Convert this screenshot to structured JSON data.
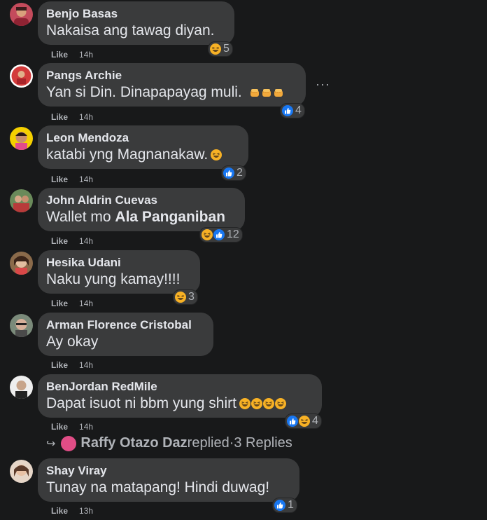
{
  "comments": [
    {
      "name": "Benjo Basas",
      "text": "Nakaisa ang tawag diyan.",
      "reaction_count": "5",
      "like": "Like",
      "time": "14h"
    },
    {
      "name": "Pangs Archie",
      "text": "Yan si Din. Dinapapayag muli.",
      "reaction_count": "4",
      "like": "Like",
      "time": "14h",
      "more": "···"
    },
    {
      "name": "Leon Mendoza",
      "text": "katabi yng Magnanakaw.",
      "reaction_count": "2",
      "like": "Like",
      "time": "14h"
    },
    {
      "name": "John Aldrin Cuevas",
      "text_prefix": "Wallet mo ",
      "text_mention": "Ala Panganiban",
      "reaction_count": "12",
      "like": "Like",
      "time": "14h"
    },
    {
      "name": "Hesika Udani",
      "text": "Naku yung kamay!!!!",
      "reaction_count": "3",
      "like": "Like",
      "time": "14h"
    },
    {
      "name": "Arman Florence Cristobal",
      "text": "Ay okay",
      "like": "Like",
      "time": "14h"
    },
    {
      "name": "BenJordan RedMile",
      "text": "Dapat isuot ni bbm yung shirt",
      "reaction_count": "4",
      "like": "Like",
      "time": "14h"
    },
    {
      "name": "Shay Viray",
      "text": "Tunay na matapang! Hindi duwag!",
      "reaction_count": "1",
      "like": "Like",
      "time": "13h"
    }
  ],
  "reply": {
    "arrow": "↪",
    "name": "Raffy Otazo Daz",
    "suffix": " replied",
    "separator": " · ",
    "count": "3 Replies"
  },
  "colors": {
    "background": "#18191a",
    "bubble": "#3a3b3c",
    "like_blue": "#1877f2",
    "haha_yellow": "#f7b125"
  },
  "icons": [
    "haha-icon",
    "like-icon",
    "fist-icon",
    "more-icon",
    "reply-arrow-icon"
  ]
}
